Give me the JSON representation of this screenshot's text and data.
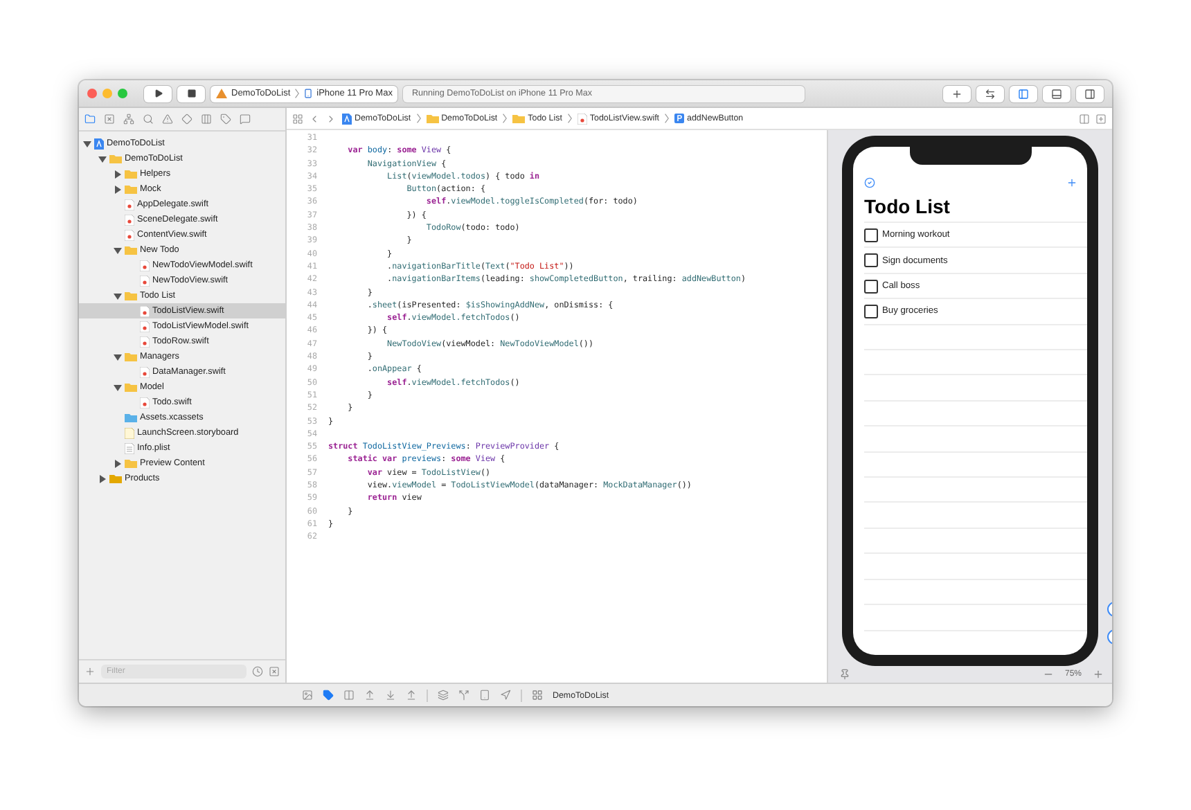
{
  "toolbar": {
    "scheme": "DemoToDoList",
    "destination": "iPhone 11 Pro Max",
    "activity": "Running DemoToDoList on iPhone 11 Pro Max"
  },
  "navigator": {
    "tree": [
      {
        "label": "DemoToDoList",
        "kind": "project",
        "expanded": true,
        "selected": false,
        "children": [
          {
            "label": "DemoToDoList",
            "kind": "folder",
            "expanded": true,
            "selected": false,
            "children": [
              {
                "label": "Helpers",
                "kind": "folder",
                "expanded": false,
                "selected": false
              },
              {
                "label": "Mock",
                "kind": "folder",
                "expanded": false,
                "selected": false
              },
              {
                "label": "AppDelegate.swift",
                "kind": "file",
                "selected": false
              },
              {
                "label": "SceneDelegate.swift",
                "kind": "file",
                "selected": false
              },
              {
                "label": "ContentView.swift",
                "kind": "file",
                "selected": false
              },
              {
                "label": "New Todo",
                "kind": "folder",
                "expanded": true,
                "selected": false,
                "children": [
                  {
                    "label": "NewTodoViewModel.swift",
                    "kind": "file",
                    "selected": false
                  },
                  {
                    "label": "NewTodoView.swift",
                    "kind": "file",
                    "selected": false
                  }
                ]
              },
              {
                "label": "Todo List",
                "kind": "folder",
                "expanded": true,
                "selected": false,
                "children": [
                  {
                    "label": "TodoListView.swift",
                    "kind": "file",
                    "selected": true
                  },
                  {
                    "label": "TodoListViewModel.swift",
                    "kind": "file",
                    "selected": false
                  },
                  {
                    "label": "TodoRow.swift",
                    "kind": "file",
                    "selected": false
                  }
                ]
              },
              {
                "label": "Managers",
                "kind": "folder",
                "expanded": true,
                "selected": false,
                "children": [
                  {
                    "label": "DataManager.swift",
                    "kind": "file",
                    "selected": false
                  }
                ]
              },
              {
                "label": "Model",
                "kind": "folder",
                "expanded": true,
                "selected": false,
                "children": [
                  {
                    "label": "Todo.swift",
                    "kind": "file",
                    "selected": false
                  }
                ]
              },
              {
                "label": "Assets.xcassets",
                "kind": "assets",
                "selected": false
              },
              {
                "label": "LaunchScreen.storyboard",
                "kind": "storyboard",
                "selected": false
              },
              {
                "label": "Info.plist",
                "kind": "plist",
                "selected": false
              },
              {
                "label": "Preview Content",
                "kind": "folder",
                "expanded": false,
                "selected": false
              }
            ]
          },
          {
            "label": "Products",
            "kind": "products",
            "expanded": false,
            "selected": false
          }
        ]
      }
    ],
    "filter": {
      "placeholder": "Filter"
    }
  },
  "breadcrumb": [
    {
      "label": "DemoToDoList",
      "kind": "project"
    },
    {
      "label": "DemoToDoList",
      "kind": "folder"
    },
    {
      "label": "Todo List",
      "kind": "folder"
    },
    {
      "label": "TodoListView.swift",
      "kind": "file"
    },
    {
      "label": "addNewButton",
      "kind": "property"
    }
  ],
  "code_lines": [
    {
      "number": "31"
    },
    {
      "number": "32",
      "tokens": [
        {
          "kind": "kw",
          "text": "    var"
        },
        {
          "kind": "decl",
          "text": " body"
        },
        {
          "kind": "plain",
          "text": ": "
        },
        {
          "kind": "kw",
          "text": "some"
        },
        {
          "kind": "sys",
          "text": " View"
        },
        {
          "kind": "plain",
          "text": " {"
        }
      ]
    },
    {
      "number": "33",
      "tokens": [
        {
          "kind": "proj",
          "text": "        NavigationView"
        },
        {
          "kind": "plain",
          "text": " {"
        }
      ]
    },
    {
      "number": "34",
      "tokens": [
        {
          "kind": "proj",
          "text": "            List"
        },
        {
          "kind": "plain",
          "text": "("
        },
        {
          "kind": "proj",
          "text": "viewModel.todos"
        },
        {
          "kind": "plain",
          "text": ") { todo "
        },
        {
          "kind": "kw",
          "text": "in"
        }
      ]
    },
    {
      "number": "35",
      "tokens": [
        {
          "kind": "proj",
          "text": "                Button"
        },
        {
          "kind": "plain",
          "text": "(action: {"
        }
      ]
    },
    {
      "number": "36",
      "tokens": [
        {
          "kind": "kw",
          "text": "                    self"
        },
        {
          "kind": "plain",
          "text": "."
        },
        {
          "kind": "proj",
          "text": "viewModel.toggleIsCompleted"
        },
        {
          "kind": "plain",
          "text": "(for: todo)"
        }
      ]
    },
    {
      "number": "37",
      "tokens": [
        {
          "kind": "plain",
          "text": "                }) {"
        }
      ]
    },
    {
      "number": "38",
      "tokens": [
        {
          "kind": "proj",
          "text": "                    TodoRow"
        },
        {
          "kind": "plain",
          "text": "(todo: todo)"
        }
      ]
    },
    {
      "number": "39",
      "tokens": [
        {
          "kind": "plain",
          "text": "                }"
        }
      ]
    },
    {
      "number": "40",
      "tokens": [
        {
          "kind": "plain",
          "text": "            }"
        }
      ]
    },
    {
      "number": "41",
      "tokens": [
        {
          "kind": "plain",
          "text": "            ."
        },
        {
          "kind": "proj",
          "text": "navigationBarTitle"
        },
        {
          "kind": "plain",
          "text": "("
        },
        {
          "kind": "proj",
          "text": "Text"
        },
        {
          "kind": "plain",
          "text": "("
        },
        {
          "kind": "str",
          "text": "\"Todo List\""
        },
        {
          "kind": "plain",
          "text": "))"
        }
      ]
    },
    {
      "number": "42",
      "tokens": [
        {
          "kind": "plain",
          "text": "            ."
        },
        {
          "kind": "proj",
          "text": "navigationBarItems"
        },
        {
          "kind": "plain",
          "text": "(leading: "
        },
        {
          "kind": "proj",
          "text": "showCompletedButton"
        },
        {
          "kind": "plain",
          "text": ", trailing: "
        },
        {
          "kind": "proj",
          "text": "addNewButton"
        },
        {
          "kind": "plain",
          "text": ")"
        }
      ]
    },
    {
      "number": "43",
      "tokens": [
        {
          "kind": "plain",
          "text": "        }"
        }
      ]
    },
    {
      "number": "44",
      "tokens": [
        {
          "kind": "plain",
          "text": "        ."
        },
        {
          "kind": "proj",
          "text": "sheet"
        },
        {
          "kind": "plain",
          "text": "(isPresented: "
        },
        {
          "kind": "proj",
          "text": "$isShowingAddNew"
        },
        {
          "kind": "plain",
          "text": ", onDismiss: {"
        }
      ]
    },
    {
      "number": "45",
      "tokens": [
        {
          "kind": "kw",
          "text": "            self"
        },
        {
          "kind": "plain",
          "text": "."
        },
        {
          "kind": "proj",
          "text": "viewModel.fetchTodos"
        },
        {
          "kind": "plain",
          "text": "()"
        }
      ]
    },
    {
      "number": "46",
      "tokens": [
        {
          "kind": "plain",
          "text": "        }) {"
        }
      ]
    },
    {
      "number": "47",
      "tokens": [
        {
          "kind": "proj",
          "text": "            NewTodoView"
        },
        {
          "kind": "plain",
          "text": "(viewModel: "
        },
        {
          "kind": "proj",
          "text": "NewTodoViewModel"
        },
        {
          "kind": "plain",
          "text": "())"
        }
      ]
    },
    {
      "number": "48",
      "tokens": [
        {
          "kind": "plain",
          "text": "        }"
        }
      ]
    },
    {
      "number": "49",
      "tokens": [
        {
          "kind": "plain",
          "text": "        ."
        },
        {
          "kind": "proj",
          "text": "onAppear"
        },
        {
          "kind": "plain",
          "text": " {"
        }
      ]
    },
    {
      "number": "50",
      "tokens": [
        {
          "kind": "kw",
          "text": "            self"
        },
        {
          "kind": "plain",
          "text": "."
        },
        {
          "kind": "proj",
          "text": "viewModel.fetchTodos"
        },
        {
          "kind": "plain",
          "text": "()"
        }
      ]
    },
    {
      "number": "51",
      "tokens": [
        {
          "kind": "plain",
          "text": "        }"
        }
      ]
    },
    {
      "number": "52",
      "tokens": [
        {
          "kind": "plain",
          "text": "    }"
        }
      ]
    },
    {
      "number": "53",
      "tokens": [
        {
          "kind": "plain",
          "text": "}"
        }
      ]
    },
    {
      "number": "54"
    },
    {
      "number": "55",
      "tokens": [
        {
          "kind": "kw",
          "text": "struct"
        },
        {
          "kind": "decl",
          "text": " TodoListView_Previews"
        },
        {
          "kind": "plain",
          "text": ": "
        },
        {
          "kind": "sys",
          "text": "PreviewProvider"
        },
        {
          "kind": "plain",
          "text": " {"
        }
      ]
    },
    {
      "number": "56",
      "tokens": [
        {
          "kind": "kw",
          "text": "    static var"
        },
        {
          "kind": "decl",
          "text": " previews"
        },
        {
          "kind": "plain",
          "text": ": "
        },
        {
          "kind": "kw",
          "text": "some"
        },
        {
          "kind": "sys",
          "text": " View"
        },
        {
          "kind": "plain",
          "text": " {"
        }
      ]
    },
    {
      "number": "57",
      "tokens": [
        {
          "kind": "kw",
          "text": "        var"
        },
        {
          "kind": "plain",
          "text": " view = "
        },
        {
          "kind": "proj",
          "text": "TodoListView"
        },
        {
          "kind": "plain",
          "text": "()"
        }
      ]
    },
    {
      "number": "58",
      "tokens": [
        {
          "kind": "plain",
          "text": "        view."
        },
        {
          "kind": "proj",
          "text": "viewModel"
        },
        {
          "kind": "plain",
          "text": " = "
        },
        {
          "kind": "proj",
          "text": "TodoListViewModel"
        },
        {
          "kind": "plain",
          "text": "(dataManager: "
        },
        {
          "kind": "proj",
          "text": "MockDataManager"
        },
        {
          "kind": "plain",
          "text": "())"
        }
      ]
    },
    {
      "number": "59",
      "tokens": [
        {
          "kind": "kw",
          "text": "        return"
        },
        {
          "kind": "plain",
          "text": " view"
        }
      ]
    },
    {
      "number": "60",
      "tokens": [
        {
          "kind": "plain",
          "text": "    }"
        }
      ]
    },
    {
      "number": "61",
      "tokens": [
        {
          "kind": "plain",
          "text": "}"
        }
      ]
    },
    {
      "number": "62"
    }
  ],
  "preview": {
    "title": "Todo List",
    "todos": [
      {
        "text": "Morning workout",
        "checked": false
      },
      {
        "text": "Sign documents",
        "checked": false
      },
      {
        "text": "Call boss",
        "checked": false
      },
      {
        "text": "Buy groceries",
        "checked": false
      }
    ],
    "zoom": "75%"
  },
  "debug_bar": {
    "target": "DemoToDoList"
  }
}
